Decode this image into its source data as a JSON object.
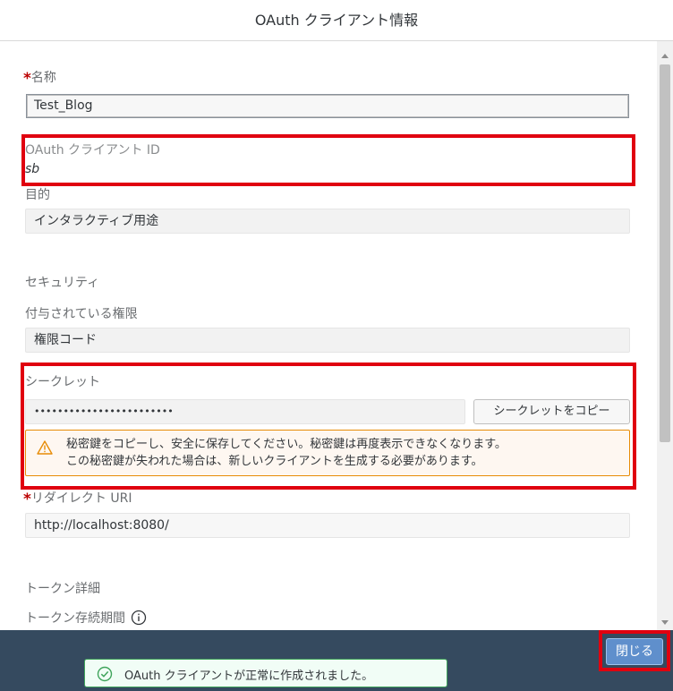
{
  "dialog": {
    "title": "OAuth クライアント情報"
  },
  "fields": {
    "name": {
      "required_mark": "*",
      "label": "名称",
      "value": "Test_Blog"
    },
    "client_id": {
      "label": "OAuth クライアント ID",
      "value": "sb"
    },
    "purpose": {
      "label": "目的",
      "value": "インタラクティブ用途"
    },
    "security_section": "セキュリティ",
    "grant": {
      "label": "付与されている権限",
      "value": "権限コード"
    },
    "secret": {
      "label": "シークレット",
      "value": "••••••••••••••••••••••••",
      "copy_button": "シークレットをコピー",
      "warning_line1": "秘密鍵をコピーし、安全に保存してください。秘密鍵は再度表示できなくなります。",
      "warning_line2": "この秘密鍵が失われた場合は、新しいクライアントを生成する必要があります。"
    },
    "redirect": {
      "required_mark": "*",
      "label": "リダイレクト URI",
      "value": "http://localhost:8080/"
    },
    "token_section": "トークン詳細",
    "token_lifetime": {
      "label": "トークン存続期間"
    }
  },
  "footer": {
    "close_button": "閉じる"
  },
  "toast": {
    "message": "OAuth クライアントが正常に作成されました。"
  },
  "colors": {
    "footer_bg": "#354a5f",
    "highlight": "#e0000f",
    "warning_border": "#e78c07",
    "success": "#3fa45b",
    "required": "#bb0000"
  }
}
